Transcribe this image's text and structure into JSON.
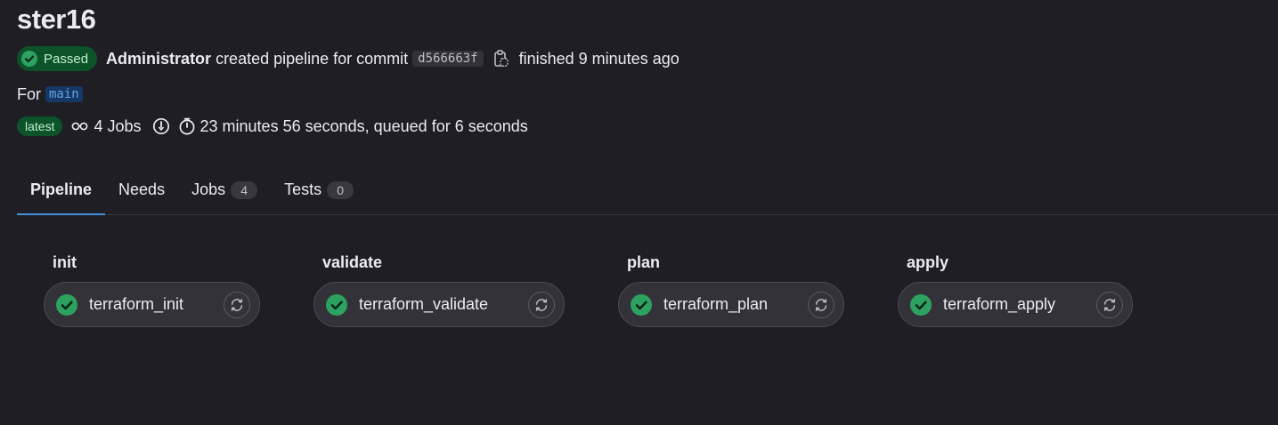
{
  "page": {
    "title": "ster16"
  },
  "pipeline_header": {
    "status": "Passed",
    "author": "Administrator",
    "action_text": "created pipeline for commit",
    "commit_sha": "d566663f",
    "finished_text": "finished 9 minutes ago",
    "for_label": "For",
    "ref": "main",
    "latest_badge": "latest",
    "jobs_text": "4 Jobs",
    "duration_text": "23 minutes 56 seconds, queued for 6 seconds"
  },
  "tabs": [
    {
      "label": "Pipeline",
      "count": ""
    },
    {
      "label": "Needs",
      "count": ""
    },
    {
      "label": "Jobs",
      "count": "4"
    },
    {
      "label": "Tests",
      "count": "0"
    }
  ],
  "stages": [
    {
      "name": "init",
      "job": "terraform_init",
      "status": "success"
    },
    {
      "name": "validate",
      "job": "terraform_validate",
      "status": "success"
    },
    {
      "name": "plan",
      "job": "terraform_plan",
      "status": "success"
    },
    {
      "name": "apply",
      "job": "terraform_apply",
      "status": "success"
    }
  ],
  "colors": {
    "background": "#1f1e24",
    "success": "#2da160",
    "badge_bg": "#0d532a",
    "tab_active": "#428fdc",
    "ref_bg": "#153865",
    "ref_text": "#63a6e9"
  },
  "icons": {
    "status": "check-circle-icon",
    "copy": "clipboard-icon",
    "jobs": "pipeline-icon",
    "stuck": "timer-alert-icon",
    "duration": "stopwatch-icon",
    "retry": "retry-icon"
  }
}
